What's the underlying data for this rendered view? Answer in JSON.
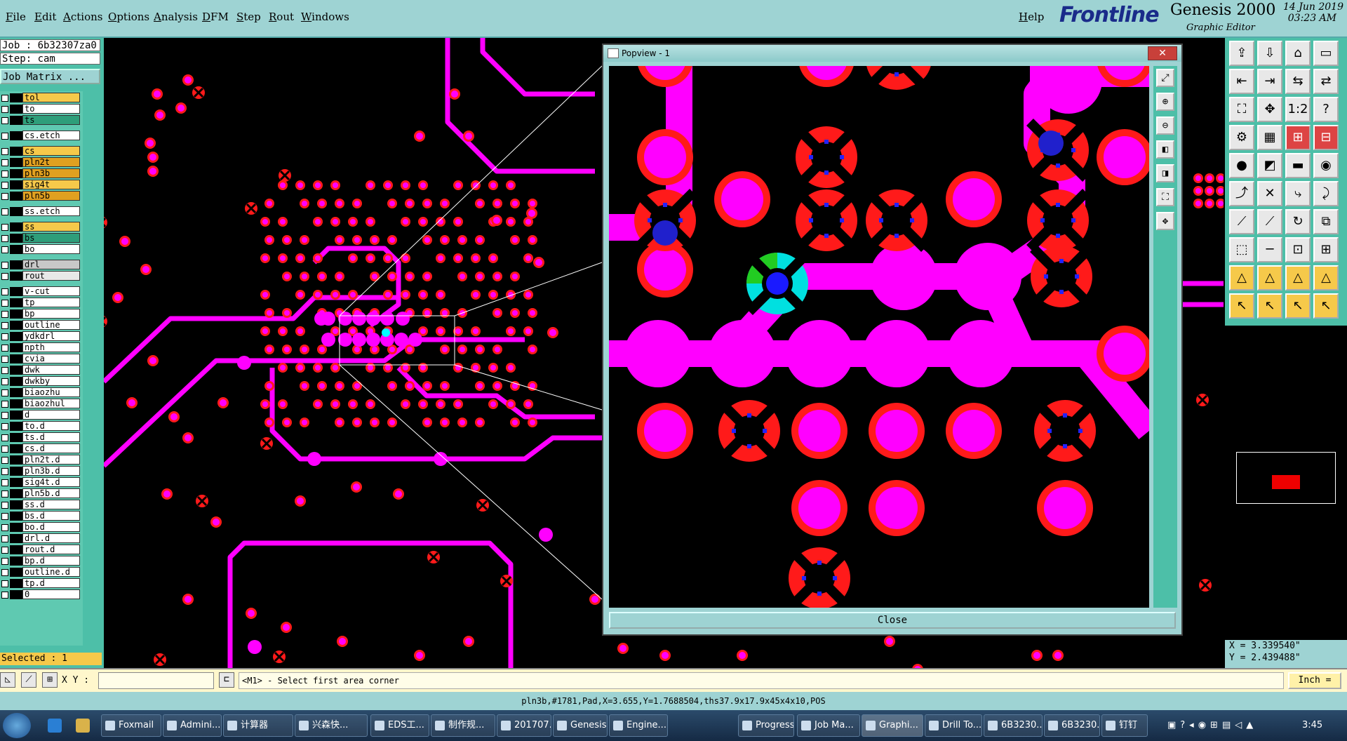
{
  "menubar": {
    "items": [
      "File",
      "Edit",
      "Actions",
      "Options",
      "Analysis",
      "DFM",
      "Step",
      "Rout",
      "Windows"
    ],
    "help": "Help"
  },
  "brand": {
    "logo": "Frontline",
    "product": "Genesis 2000",
    "subtitle": "Graphic Editor",
    "date": "14 Jun 2019",
    "time": "03:23 AM"
  },
  "job": {
    "job_label": "Job : 6b32307za0",
    "step_label": "Step: cam",
    "matrix_button": "Job Matrix ..."
  },
  "layers": [
    {
      "name": "tol",
      "color": "#f6c94a"
    },
    {
      "name": "to",
      "color": "#ffffff"
    },
    {
      "name": "ts",
      "color": "#2e9e7a"
    },
    {
      "name": "cs.etch",
      "color": "#ffffff"
    },
    {
      "name": "cs",
      "color": "#f6c94a"
    },
    {
      "name": "pln2t",
      "color": "#e0a020"
    },
    {
      "name": "pln3b",
      "color": "#e0a020"
    },
    {
      "name": "sig4t",
      "color": "#f6c94a"
    },
    {
      "name": "pln5b",
      "color": "#e0a020"
    },
    {
      "name": "ss.etch",
      "color": "#ffffff"
    },
    {
      "name": "ss",
      "color": "#f6c94a"
    },
    {
      "name": "bs",
      "color": "#2e9e7a"
    },
    {
      "name": "bo",
      "color": "#ffffff"
    },
    {
      "name": "drl",
      "color": "#c8c8c8"
    },
    {
      "name": "rout",
      "color": "#e8e8e8"
    },
    {
      "name": "v-cut",
      "color": "#ffffff"
    },
    {
      "name": "tp",
      "color": "#ffffff"
    },
    {
      "name": "bp",
      "color": "#ffffff"
    },
    {
      "name": "outline",
      "color": "#ffffff"
    },
    {
      "name": "ydkdrl",
      "color": "#ffffff"
    },
    {
      "name": "npth",
      "color": "#ffffff"
    },
    {
      "name": "cvia",
      "color": "#ffffff"
    },
    {
      "name": "dwk",
      "color": "#ffffff"
    },
    {
      "name": "dwkby",
      "color": "#ffffff"
    },
    {
      "name": "biaozhu",
      "color": "#ffffff"
    },
    {
      "name": "biaozhul",
      "color": "#ffffff"
    },
    {
      "name": "d",
      "color": "#ffffff"
    },
    {
      "name": "to.d",
      "color": "#ffffff"
    },
    {
      "name": "ts.d",
      "color": "#ffffff"
    },
    {
      "name": "cs.d",
      "color": "#ffffff"
    },
    {
      "name": "pln2t.d",
      "color": "#ffffff"
    },
    {
      "name": "pln3b.d",
      "color": "#ffffff"
    },
    {
      "name": "sig4t.d",
      "color": "#ffffff"
    },
    {
      "name": "pln5b.d",
      "color": "#ffffff"
    },
    {
      "name": "ss.d",
      "color": "#ffffff"
    },
    {
      "name": "bs.d",
      "color": "#ffffff"
    },
    {
      "name": "bo.d",
      "color": "#ffffff"
    },
    {
      "name": "drl.d",
      "color": "#ffffff"
    },
    {
      "name": "rout.d",
      "color": "#ffffff"
    },
    {
      "name": "bp.d",
      "color": "#ffffff"
    },
    {
      "name": "outline.d",
      "color": "#ffffff"
    },
    {
      "name": "tp.d",
      "color": "#ffffff"
    },
    {
      "name": "0",
      "color": "#ffffff"
    }
  ],
  "selected_count": "Selected : 1",
  "popview": {
    "title": "Popview - 1",
    "close_x": "✕",
    "close_button": "Close"
  },
  "coords": {
    "x": "X = 3.339540\"",
    "y": "Y = 2.439488\""
  },
  "status": {
    "xy_label": "X Y :",
    "xy_value": "",
    "prompt": "<M1> - Select first area corner",
    "unit": "Inch ="
  },
  "info_line": "pln3b,#1781,Pad,X=3.655,Y=1.7688504,ths37.9x17.9x45x4x10,POS",
  "taskbar": {
    "tasks": [
      "Foxmail",
      "Admini...",
      "计算器",
      "兴森快...",
      "EDS工...",
      "制作规...",
      "201707...",
      "Genesis",
      "Engine...",
      "Progress",
      "Job Ma...",
      "Graphi...",
      "Drill To...",
      "6B3230...",
      "6B3230...",
      "钉钉"
    ],
    "clock": "3:45"
  },
  "colors": {
    "copper": "#ff00ff",
    "antipad": "#ff1a1a",
    "thermal_spoke": "#2222ff",
    "panel": "#4dbfa8",
    "menubar": "#9ed3d3"
  }
}
